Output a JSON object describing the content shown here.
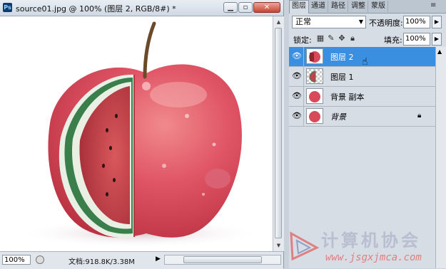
{
  "document": {
    "title": "source01.jpg @ 100% (图层 2, RGB/8#) *",
    "app_icon": "Ps",
    "window_buttons": {
      "minimize": "▁",
      "restore": "▫",
      "close": "✕"
    },
    "zoom": "100%",
    "doc_info": "文档:918.8K/3.38M",
    "status_arrow": "▶"
  },
  "panel": {
    "tabs": [
      "图层",
      "通道",
      "路径",
      "调整",
      "蒙版"
    ],
    "active_tab": "图层",
    "menu_icon": "≡",
    "blend_mode": "正常",
    "opacity_label": "不透明度:",
    "opacity_value": "100%",
    "lock_label": "锁定:",
    "fill_label": "填充:",
    "fill_value": "100%",
    "layers": [
      {
        "name": "图层 2",
        "selected": true,
        "thumb": "apple-cut"
      },
      {
        "name": "图层 1",
        "selected": false,
        "thumb": "watermelon-checker"
      },
      {
        "name": "背景 副本",
        "selected": false,
        "thumb": "apple"
      },
      {
        "name": "背景",
        "selected": false,
        "thumb": "apple",
        "locked": true
      }
    ]
  },
  "watermark": {
    "title": "计算机协会",
    "url": "www.jsgxjmca.com"
  },
  "colors": {
    "selected_row": "#3b8fe0",
    "panel_bg": "#d6dde5",
    "apple_red": "#d84a5a",
    "watermelon_flesh": "#c8404a",
    "rind": "#2f7a4a"
  }
}
